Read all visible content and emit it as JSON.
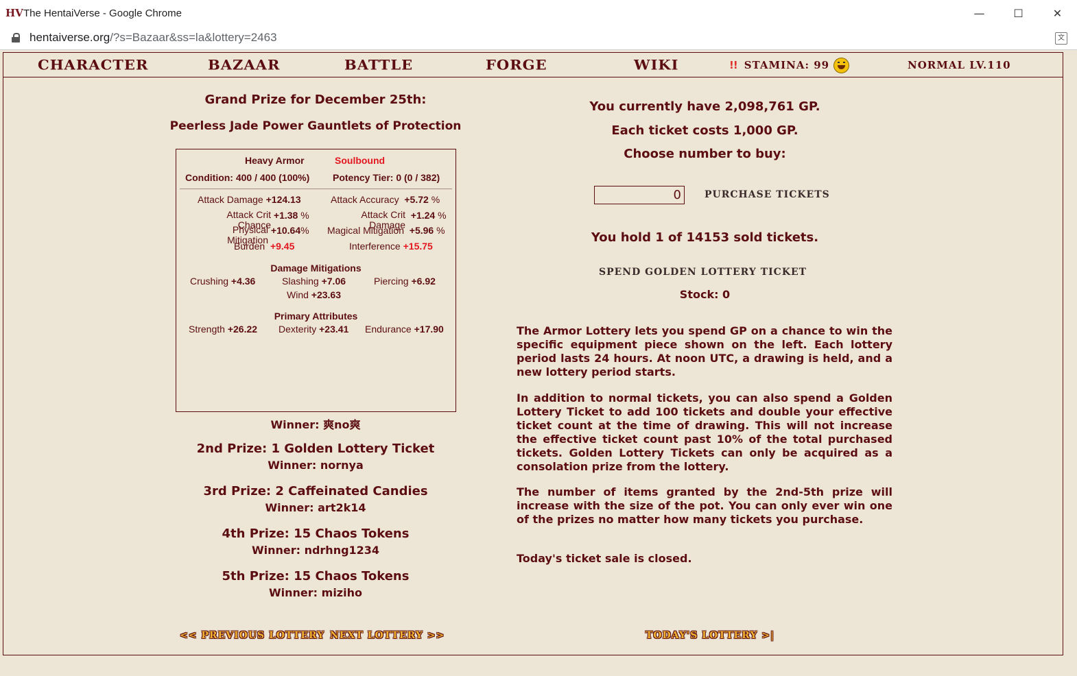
{
  "browser": {
    "window_title": "The HentaiVerse - Google Chrome",
    "url_host": "hentaiverse.org",
    "url_path": "/?s=Bazaar&ss=la&lottery=2463"
  },
  "nav": {
    "character": "CHARACTER",
    "bazaar": "BAZAAR",
    "battle": "BATTLE",
    "forge": "FORGE",
    "wiki": "WIKI",
    "stamina_alert": "!!",
    "stamina": "STAMINA: 99",
    "level": "NORMAL LV.110"
  },
  "grand_prize": {
    "title": "Grand Prize for December 25th:",
    "item_name": "Peerless Jade Power Gauntlets of Protection",
    "winner": "Winner: 爽no爽"
  },
  "equipment": {
    "type": "Heavy Armor",
    "soulbound": "Soulbound",
    "condition": "Condition: 400 / 400 (100%)",
    "potency": "Potency Tier: 0 (0 / 382)",
    "stats": {
      "attack_damage_label": "Attack Damage",
      "attack_damage_value": "+124.13",
      "attack_accuracy_label": "Attack Accuracy",
      "attack_accuracy_value": "+5.72",
      "attack_crit_chance_label": "Attack Crit Chance",
      "attack_crit_chance_value": "+1.38",
      "attack_crit_damage_label": "Attack Crit Damage",
      "attack_crit_damage_value": "+1.24",
      "physical_mitigation_label": "Physical Mitigation",
      "physical_mitigation_value": "+10.64",
      "magical_mitigation_label": "Magical Mitigation",
      "magical_mitigation_value": "+5.96",
      "burden_label": "Burden",
      "burden_value": "+9.45",
      "interference_label": "Interference",
      "interference_value": "+15.75",
      "percent": "%"
    },
    "damage_mitigations_title": "Damage Mitigations",
    "crushing_label": "Crushing",
    "crushing_value": "+4.36",
    "slashing_label": "Slashing",
    "slashing_value": "+7.06",
    "piercing_label": "Piercing",
    "piercing_value": "+6.92",
    "wind_label": "Wind",
    "wind_value": "+23.63",
    "primary_attributes_title": "Primary Attributes",
    "strength_label": "Strength",
    "strength_value": "+26.22",
    "dexterity_label": "Dexterity",
    "dexterity_value": "+23.41",
    "endurance_label": "Endurance",
    "endurance_value": "+17.90"
  },
  "prizes": [
    {
      "title": "2nd Prize: 1 Golden Lottery Ticket",
      "winner": "Winner: nornya"
    },
    {
      "title": "3rd Prize: 2 Caffeinated Candies",
      "winner": "Winner: art2k14"
    },
    {
      "title": "4th Prize: 15 Chaos Tokens",
      "winner": "Winner: ndrhng1234"
    },
    {
      "title": "5th Prize: 15 Chaos Tokens",
      "winner": "Winner: miziho"
    }
  ],
  "purchase": {
    "gp_have": "You currently have 2,098,761 GP.",
    "ticket_cost": "Each ticket costs 1,000 GP.",
    "choose": "Choose number to buy:",
    "quantity": "0",
    "purchase_button": "PURCHASE TICKETS",
    "hold": "You hold 1 of 14153 sold tickets.",
    "golden_button": "SPEND GOLDEN LOTTERY TICKET",
    "stock": "Stock: 0"
  },
  "description": {
    "p1": "The Armor Lottery lets you spend GP on a chance to win the specific equipment piece shown on the left. Each lottery period lasts 24 hours. At noon UTC, a drawing is held, and a new lottery period starts.",
    "p2": "In addition to normal tickets, you can also spend a Golden Lottery Ticket to add 100 tickets and double your effective ticket count at the time of drawing. This will not increase the effective ticket count past 10% of the total purchased tickets. Golden Lottery Tickets can only be acquired as a consolation prize from the lottery.",
    "p3": "The number of items granted by the 2nd-5th prize will increase with the size of the pot. You can only ever win one of the prizes no matter how many tickets you purchase.",
    "p4": "Today's ticket sale is closed."
  },
  "footer": {
    "previous": "<< PREVIOUS LOTTERY",
    "next": "NEXT LOTTERY >>",
    "today": "TODAY'S LOTTERY >|"
  }
}
